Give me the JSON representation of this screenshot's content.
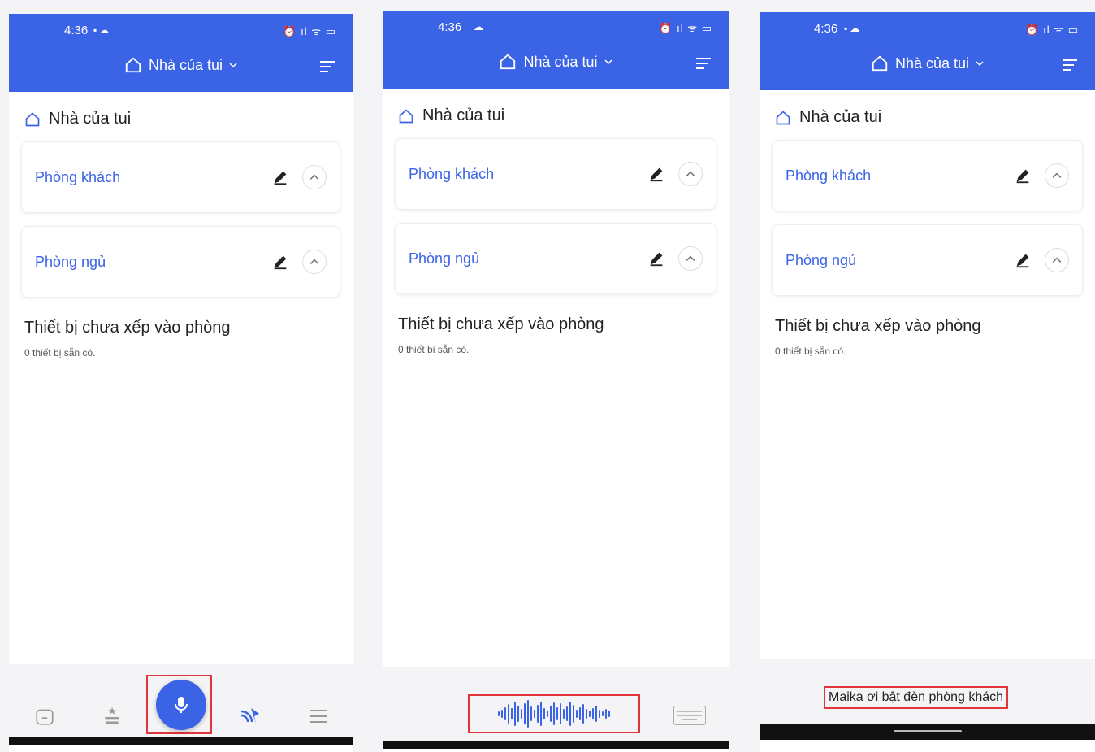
{
  "status": {
    "time": "4:36"
  },
  "header": {
    "home_name": "Nhà của tui"
  },
  "content": {
    "home_label": "Nhà của tui",
    "rooms": [
      {
        "name": "Phòng khách"
      },
      {
        "name": "Phòng ngủ"
      }
    ],
    "unassigned_title": "Thiết bị chưa xếp vào phòng",
    "unassigned_count": "0 thiết bị sẵn có."
  },
  "voice": {
    "transcript": "Maika ơi bật đèn phòng khách"
  },
  "colors": {
    "accent": "#3b63e6",
    "highlight": "#e0353b"
  }
}
